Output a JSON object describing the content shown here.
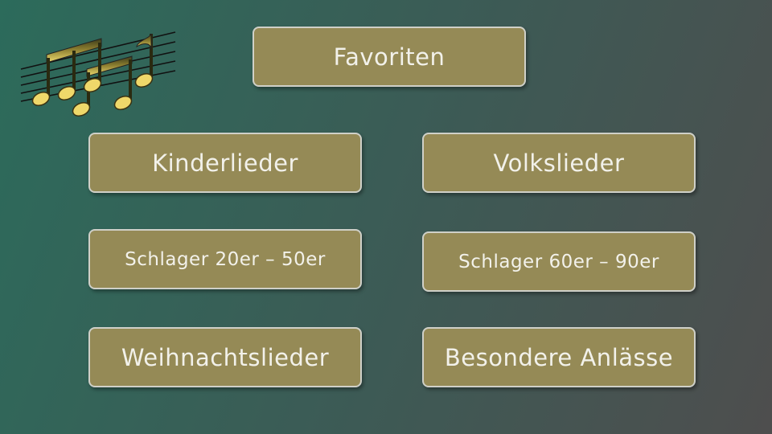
{
  "logo": {
    "icon": "music-notes-icon"
  },
  "menu": {
    "favorites": "Favoriten",
    "children_songs": "Kinderlieder",
    "folk_songs": "Volkslieder",
    "schlager_20_50": "Schlager 20er – 50er",
    "schlager_60_90": "Schlager 60er – 90er",
    "christmas_songs": "Weihnachtslieder",
    "special_occasions": "Besondere Anlässe"
  },
  "colors": {
    "button_fill": "#958a56",
    "button_border": "#cfd0c8",
    "button_text": "#f2f1ea",
    "background_start": "#2c6b5b",
    "background_end": "#4e4e4e",
    "note_gold": "#e8d36a"
  }
}
